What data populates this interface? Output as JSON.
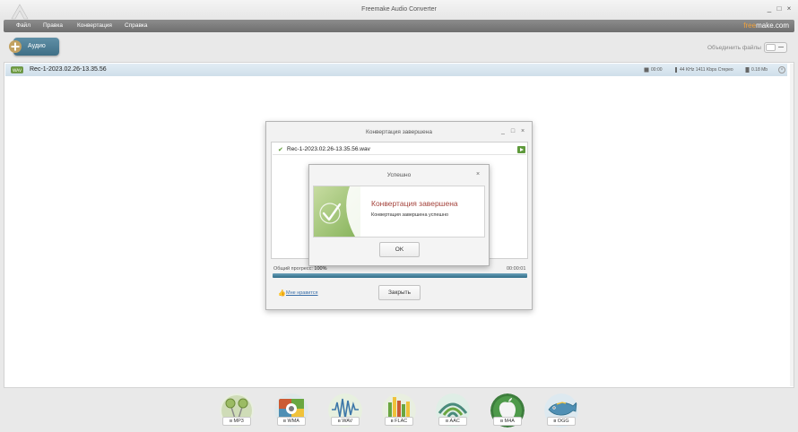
{
  "window": {
    "title": "Freemake Audio Converter",
    "controls": [
      "_",
      "□",
      "×"
    ]
  },
  "menu": {
    "items": [
      "Файл",
      "Правка",
      "Конвертация",
      "Справка"
    ],
    "brand_prefix": "free",
    "brand_suffix": "make.com"
  },
  "toolbar": {
    "audio_label": "Аудио",
    "join_label": "Объединить файлы"
  },
  "files": [
    {
      "name": "Rec-1-2023.02.26-13.35.56",
      "duration": "00:00",
      "format": "44 KHz  1411 Kbps  Стерео",
      "size": "0.18 Mb"
    }
  ],
  "convert_dialog": {
    "title": "Конвертация завершена",
    "controls": [
      "_",
      "□",
      "×"
    ],
    "item_name": "Rec-1-2023.02.26-13.35.56.wav",
    "progress_label": "Общий прогресс:",
    "progress_value": "100%",
    "progress": 1.0,
    "elapsed": "00:00:01",
    "like_label": "Мне нравится",
    "close_label": "Закрыть"
  },
  "success_dialog": {
    "title": "Успешно",
    "close": "×",
    "heading": "Конвертация завершена",
    "message": "Конвертация завершена успешно",
    "ok_label": "OK"
  },
  "formats": [
    {
      "label": "в MP3",
      "icon": "mp3-icon",
      "color": "#9bbb63"
    },
    {
      "label": "в WMA",
      "icon": "wma-icon",
      "color": "#cc5b33"
    },
    {
      "label": "в WAV",
      "icon": "wav-icon",
      "color": "#5f9bc0"
    },
    {
      "label": "в FLAC",
      "icon": "flac-icon",
      "color": "#6aa640"
    },
    {
      "label": "в AAC",
      "icon": "aac-icon",
      "color": "#4a8b7c"
    },
    {
      "label": "в M4A",
      "icon": "m4a-icon",
      "color": "#3d7d3d"
    },
    {
      "label": "в OGG",
      "icon": "ogg-icon",
      "color": "#4f8fb4"
    }
  ],
  "colors": {
    "accent": "#3f6f86",
    "heading_red": "#a4433c",
    "success_green": "#5a9a32",
    "brand_orange": "#f2a23b"
  }
}
